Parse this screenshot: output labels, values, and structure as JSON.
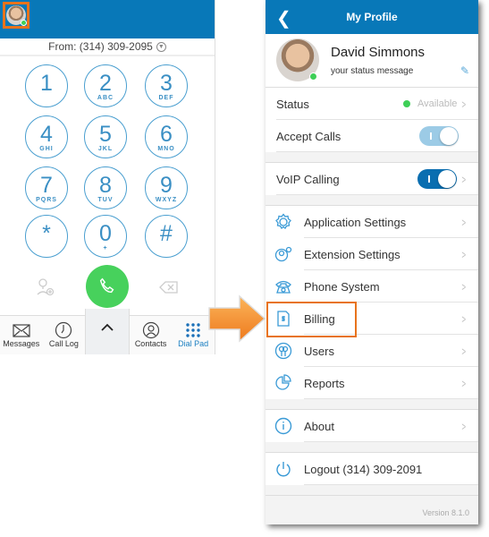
{
  "dialer": {
    "from_label": "From: (314) 309-2095",
    "keys": [
      {
        "n": "1",
        "l": ""
      },
      {
        "n": "2",
        "l": "ABC"
      },
      {
        "n": "3",
        "l": "DEF"
      },
      {
        "n": "4",
        "l": "GHI"
      },
      {
        "n": "5",
        "l": "JKL"
      },
      {
        "n": "6",
        "l": "MNO"
      },
      {
        "n": "7",
        "l": "PQRS"
      },
      {
        "n": "8",
        "l": "TUV"
      },
      {
        "n": "9",
        "l": "WXYZ"
      },
      {
        "n": "*",
        "l": ""
      },
      {
        "n": "0",
        "l": "+"
      },
      {
        "n": "#",
        "l": ""
      }
    ],
    "tabs": [
      {
        "label": "Messages",
        "icon": "envelope-icon"
      },
      {
        "label": "Call Log",
        "icon": "clock-icon"
      },
      {
        "label": "",
        "icon": "chevron-up-icon"
      },
      {
        "label": "Contacts",
        "icon": "contact-icon"
      },
      {
        "label": "Dial Pad",
        "icon": "dialpad-icon",
        "active": true
      }
    ]
  },
  "profile": {
    "title": "My Profile",
    "name": "David Simmons",
    "status_message": "your status message",
    "status_label": "Status",
    "status_value": "Available",
    "accept_calls": "Accept Calls",
    "accept_calls_on": true,
    "voip": "VoIP Calling",
    "voip_on": true,
    "menu": [
      {
        "label": "Application Settings",
        "icon": "gear-icon"
      },
      {
        "label": "Extension Settings",
        "icon": "extension-icon"
      },
      {
        "label": "Phone System",
        "icon": "phone-system-icon"
      },
      {
        "label": "Billing",
        "icon": "billing-icon",
        "highlighted": true
      },
      {
        "label": "Users",
        "icon": "users-icon"
      },
      {
        "label": "Reports",
        "icon": "pie-chart-icon"
      }
    ],
    "about": "About",
    "logout": "Logout (314) 309-2091",
    "version": "Version 8.1.0"
  },
  "colors": {
    "header": "#0878b8",
    "accent": "#1a7fc1",
    "call": "#47d15c",
    "highlight": "#e8731c",
    "online": "#3ecf57"
  }
}
